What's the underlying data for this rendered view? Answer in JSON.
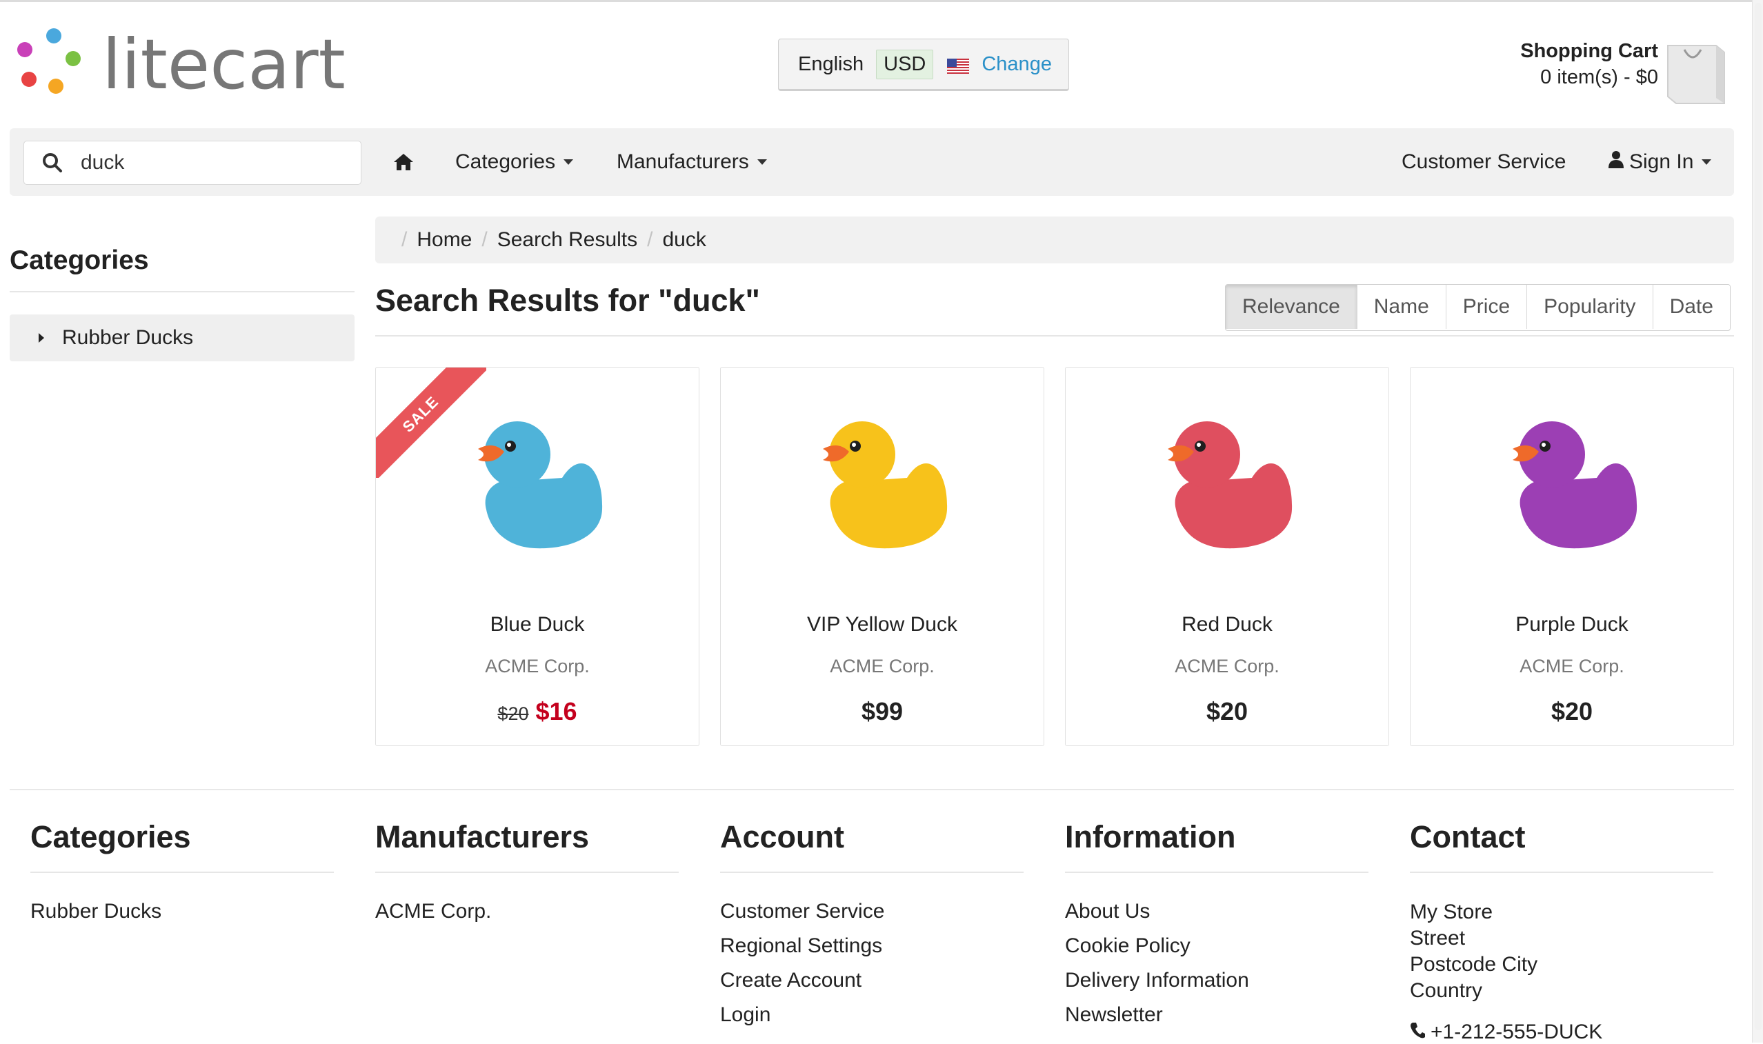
{
  "header": {
    "logo_text": "litecart",
    "region": {
      "language": "English",
      "currency": "USD",
      "change_label": "Change"
    },
    "cart": {
      "title": "Shopping Cart",
      "summary": "0 item(s) - $0"
    }
  },
  "nav": {
    "search_value": "duck",
    "home_icon": "home-icon",
    "items": [
      {
        "label": "Categories"
      },
      {
        "label": "Manufacturers"
      },
      {
        "label": "Customer Service"
      },
      {
        "label": "Sign In"
      }
    ]
  },
  "sidebar": {
    "title": "Categories",
    "items": [
      {
        "label": "Rubber Ducks"
      }
    ]
  },
  "breadcrumb": [
    "Home",
    "Search Results",
    "duck"
  ],
  "results": {
    "title": "Search Results for \"duck\"",
    "sort_options": [
      "Relevance",
      "Name",
      "Price",
      "Popularity",
      "Date"
    ],
    "active_sort": "Relevance"
  },
  "products": [
    {
      "name": "Blue Duck",
      "manufacturer": "ACME Corp.",
      "regular_price": "$20",
      "sale_price": "$16",
      "badge": "SALE",
      "color": "#4fb3d9"
    },
    {
      "name": "VIP Yellow Duck",
      "manufacturer": "ACME Corp.",
      "price": "$99",
      "color": "#f7c21b"
    },
    {
      "name": "Red Duck",
      "manufacturer": "ACME Corp.",
      "price": "$20",
      "color": "#df4f5f"
    },
    {
      "name": "Purple Duck",
      "manufacturer": "ACME Corp.",
      "price": "$20",
      "color": "#9c3fb4"
    }
  ],
  "footer": {
    "categories": {
      "title": "Categories",
      "links": [
        "Rubber Ducks"
      ]
    },
    "manufacturers": {
      "title": "Manufacturers",
      "links": [
        "ACME Corp."
      ]
    },
    "account": {
      "title": "Account",
      "links": [
        "Customer Service",
        "Regional Settings",
        "Create Account",
        "Login"
      ]
    },
    "information": {
      "title": "Information",
      "links": [
        "About Us",
        "Cookie Policy",
        "Delivery Information",
        "Newsletter"
      ]
    },
    "contact": {
      "title": "Contact",
      "address": [
        "My Store",
        "Street",
        "Postcode City",
        "Country"
      ],
      "phone": "+1-212-555-DUCK"
    }
  },
  "colors": {
    "accent_link": "#2a90c8",
    "sale_price": "#c4001d",
    "sale_ribbon": "#e8555a"
  }
}
